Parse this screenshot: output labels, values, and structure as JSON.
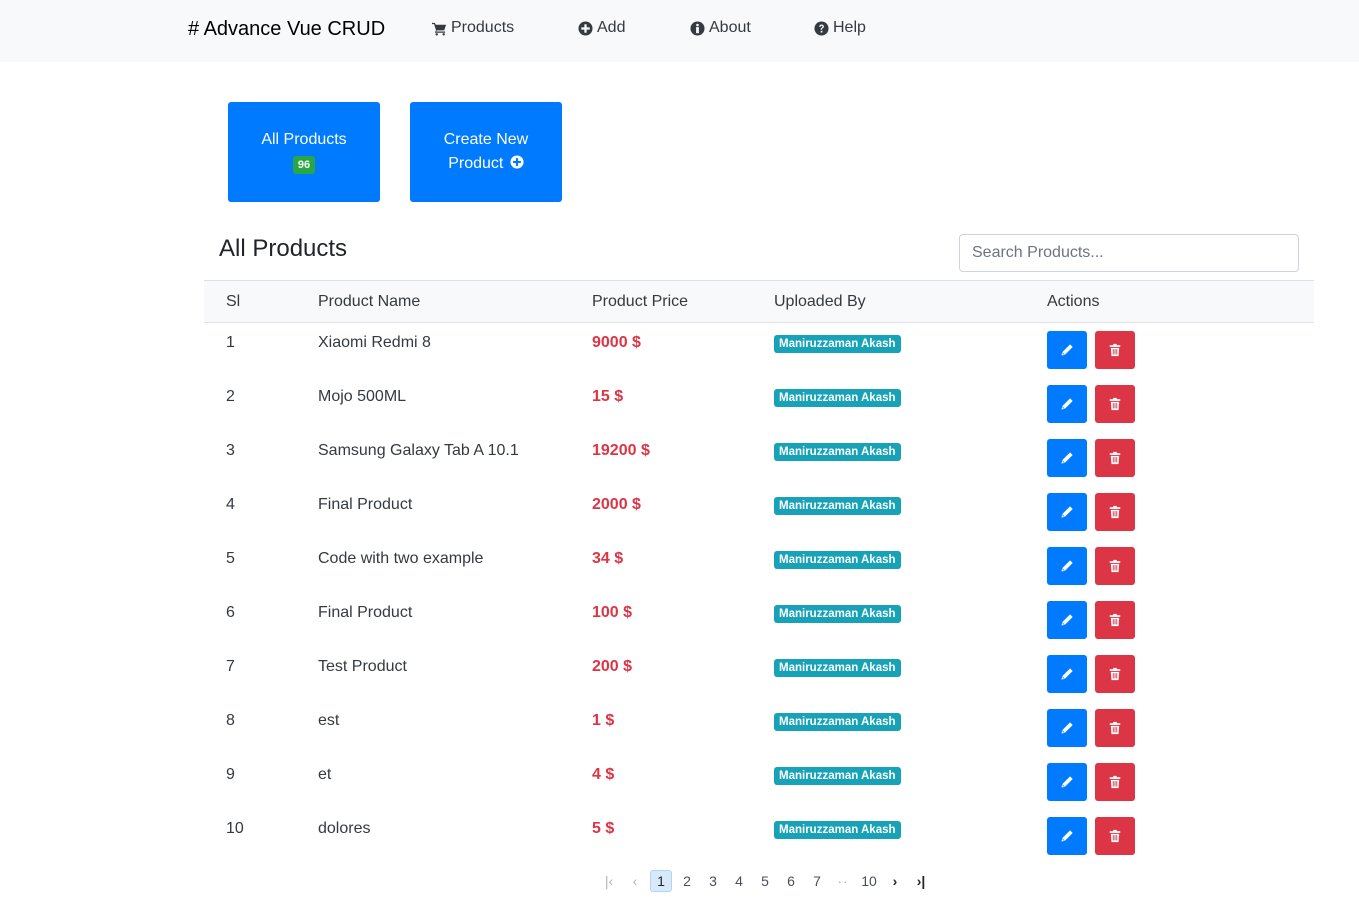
{
  "navbar": {
    "brand": "# Advance Vue CRUD",
    "items": [
      {
        "label": "Products",
        "icon": "cart-icon"
      },
      {
        "label": "Add",
        "icon": "plus-circle-icon"
      },
      {
        "label": "About",
        "icon": "info-circle-icon"
      },
      {
        "label": "Help",
        "icon": "question-circle-icon"
      }
    ]
  },
  "tiles": {
    "all_products": {
      "label": "All Products",
      "count": "96"
    },
    "create_new": {
      "label_line1": "Create New",
      "label_line2": "Product"
    }
  },
  "section": {
    "title": "All Products",
    "search_placeholder": "Search Products..."
  },
  "table": {
    "headers": [
      "Sl",
      "Product Name",
      "Product Price",
      "Uploaded By",
      "Actions"
    ],
    "rows": [
      {
        "sl": "1",
        "name": "Xiaomi Redmi 8",
        "price": "9000 $",
        "uploaded_by": "Maniruzzaman Akash"
      },
      {
        "sl": "2",
        "name": "Mojo 500ML",
        "price": "15 $",
        "uploaded_by": "Maniruzzaman Akash"
      },
      {
        "sl": "3",
        "name": "Samsung Galaxy Tab A 10.1",
        "price": "19200 $",
        "uploaded_by": "Maniruzzaman Akash"
      },
      {
        "sl": "4",
        "name": "Final Product",
        "price": "2000 $",
        "uploaded_by": "Maniruzzaman Akash"
      },
      {
        "sl": "5",
        "name": "Code with two example",
        "price": "34 $",
        "uploaded_by": "Maniruzzaman Akash"
      },
      {
        "sl": "6",
        "name": "Final Product",
        "price": "100 $",
        "uploaded_by": "Maniruzzaman Akash"
      },
      {
        "sl": "7",
        "name": "Test Product",
        "price": "200 $",
        "uploaded_by": "Maniruzzaman Akash"
      },
      {
        "sl": "8",
        "name": "est",
        "price": "1 $",
        "uploaded_by": "Maniruzzaman Akash"
      },
      {
        "sl": "9",
        "name": "et",
        "price": "4 $",
        "uploaded_by": "Maniruzzaman Akash"
      },
      {
        "sl": "10",
        "name": "dolores",
        "price": "5 $",
        "uploaded_by": "Maniruzzaman Akash"
      }
    ]
  },
  "pagination": {
    "first": "|‹",
    "prev": "‹",
    "pages": [
      "1",
      "2",
      "3",
      "4",
      "5",
      "6",
      "7"
    ],
    "ellipsis": "··",
    "last_page": "10",
    "next": "›",
    "last": "›|",
    "current": "1"
  },
  "colors": {
    "primary": "#007bff",
    "danger": "#dc3545",
    "success": "#28a745",
    "info": "#17a2b8"
  }
}
